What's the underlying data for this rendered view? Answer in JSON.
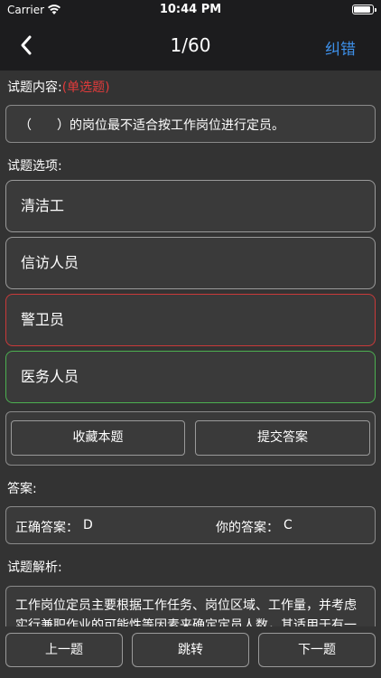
{
  "status": {
    "carrier": "Carrier",
    "time": "10:44 PM",
    "battery_level": 0.9
  },
  "nav": {
    "title": "1/60",
    "correct_label": "纠错"
  },
  "question": {
    "label": "试题内容:",
    "type_tag": "(单选题)",
    "text": "（　　）的岗位最不适合按工作岗位进行定员。"
  },
  "options_label": "试题选项:",
  "options": [
    {
      "text": "清洁工",
      "state": "normal"
    },
    {
      "text": "信访人员",
      "state": "normal"
    },
    {
      "text": "警卫员",
      "state": "wrong"
    },
    {
      "text": "医务人员",
      "state": "correct"
    }
  ],
  "actions": {
    "favorite": "收藏本题",
    "submit": "提交答案"
  },
  "answer": {
    "label": "答案:",
    "correct_label": "正确答案：",
    "correct_value": "D",
    "yours_label": "你的答案：",
    "yours_value": "C"
  },
  "analysis": {
    "label": "试题解析:",
    "text": "工作岗位定员主要根据工作任务、岗位区域、工作量，并考虑实行兼职作业的可能性等因素来确定定员人数，其适用于有一"
  },
  "bottom": {
    "prev": "上一题",
    "jump": "跳转",
    "next": "下一题"
  },
  "colors": {
    "accent": "#3d8fe8",
    "wrong": "#c93a3a",
    "correct": "#4caf50",
    "tag": "#e23b3b"
  }
}
